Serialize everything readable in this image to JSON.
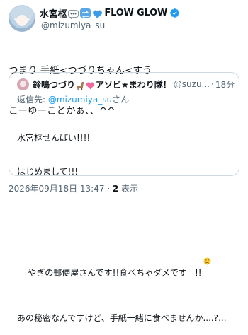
{
  "author": {
    "display_name": "水宮枢",
    "display_name_suffix": "FLOW GLOW",
    "handle": "@mizumiya_su",
    "badge_icons": [
      "speech-bubble-icon",
      "arrows-badge-icon",
      "blue-heart-icon"
    ],
    "verified_icon": "verified-badge-icon"
  },
  "tweet": {
    "line1": "つまり 手紙<つづりちゃん<すう",
    "line2": "こーゆーことかぁ、、^^"
  },
  "quote": {
    "display_name_part1": "鈴鳴つづり",
    "display_name_part2": "アソビ★まわり隊！",
    "handle": "@suzu...",
    "separator": "·",
    "time": "18分",
    "reply_prefix": "返信先: ",
    "reply_mention": "@mizumiya_su",
    "reply_suffix": "さん",
    "lines": [
      "水宮枢せんぱい!!!!",
      "はじめまして!!!",
      "",
      "やぎの郵便屋さんです!!食べちゃダメです",
      "あの秘密なんですけど、手紙一緒に食べませんか....?..."
    ],
    "emoji_after_line4": "crying-face-icon",
    "line4_tail": "!!"
  },
  "meta": {
    "timestamp": "2026年09月18日 13:47",
    "separator": "·",
    "views_count": "2",
    "views_label": "表示"
  },
  "colors": {
    "accent": "#1d9bf0",
    "secondary_text": "#536471",
    "border": "#cfd9de"
  }
}
